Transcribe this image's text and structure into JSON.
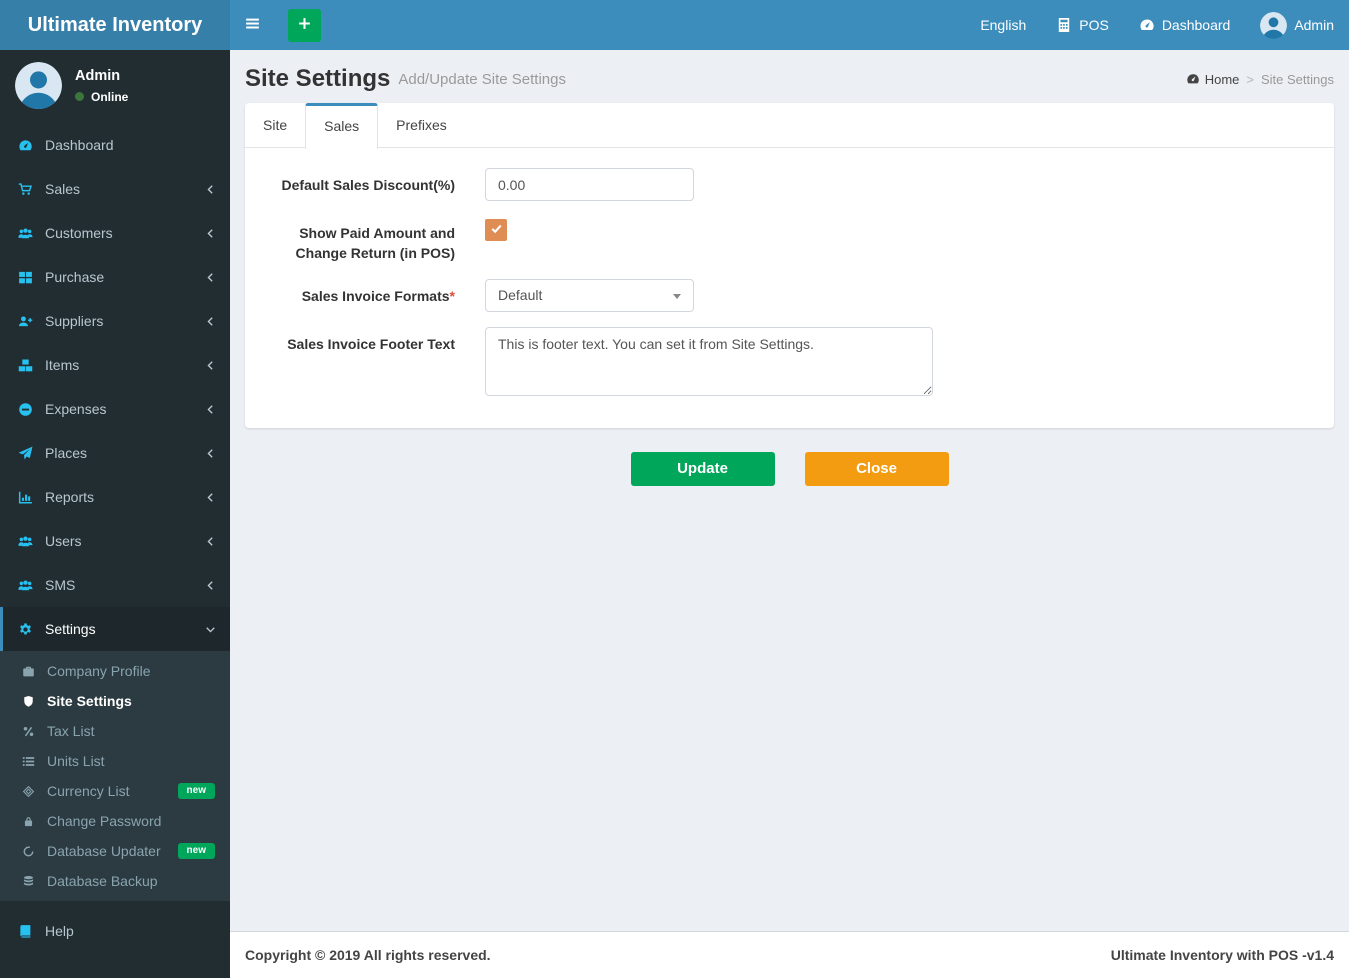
{
  "brand": {
    "title": "Ultimate Inventory"
  },
  "navbar": {
    "language": "English",
    "pos": {
      "label": "POS",
      "icon": "calculator"
    },
    "dashboard": {
      "label": "Dashboard",
      "icon": "gauge"
    },
    "user": {
      "label": "Admin",
      "icon": "person-avatar"
    }
  },
  "user_panel": {
    "name": "Admin",
    "status": "Online"
  },
  "sidebar": {
    "items": [
      {
        "label": "Dashboard",
        "icon": "gauge"
      },
      {
        "label": "Sales",
        "icon": "cart"
      },
      {
        "label": "Customers",
        "icon": "users"
      },
      {
        "label": "Purchase",
        "icon": "grid"
      },
      {
        "label": "Suppliers",
        "icon": "user-plus"
      },
      {
        "label": "Items",
        "icon": "cubes"
      },
      {
        "label": "Expenses",
        "icon": "minus-circle"
      },
      {
        "label": "Places",
        "icon": "paper-plane"
      },
      {
        "label": "Reports",
        "icon": "bar-chart"
      },
      {
        "label": "Users",
        "icon": "users"
      },
      {
        "label": "SMS",
        "icon": "users"
      },
      {
        "label": "Settings",
        "icon": "gears"
      }
    ],
    "settings_submenu": [
      {
        "label": "Company Profile",
        "icon": "briefcase"
      },
      {
        "label": "Site Settings",
        "icon": "shield"
      },
      {
        "label": "Tax List",
        "icon": "percent"
      },
      {
        "label": "Units List",
        "icon": "list"
      },
      {
        "label": "Currency List",
        "icon": "diamond",
        "badge": "new"
      },
      {
        "label": "Change Password",
        "icon": "lock"
      },
      {
        "label": "Database Updater",
        "icon": "circle-open",
        "badge": "new"
      },
      {
        "label": "Database Backup",
        "icon": "database"
      }
    ],
    "help_item": {
      "label": "Help",
      "icon": "book"
    }
  },
  "page": {
    "title": "Site Settings",
    "subtitle": "Add/Update Site Settings",
    "breadcrumb": {
      "home": "Home",
      "current": "Site Settings"
    }
  },
  "tabs": [
    {
      "label": "Site"
    },
    {
      "label": "Sales"
    },
    {
      "label": "Prefixes"
    }
  ],
  "form": {
    "discount": {
      "label": "Default Sales Discount(%)",
      "value": "0.00"
    },
    "paid_amount": {
      "label": "Show Paid Amount and Change Return (in POS)",
      "checked": true
    },
    "invoice_format": {
      "label": "Sales Invoice Formats",
      "required_mark": "*",
      "value": "Default"
    },
    "footer_text": {
      "label": "Sales Invoice Footer Text",
      "value": "This is footer text. You can set it from Site Settings."
    }
  },
  "actions": {
    "update": "Update",
    "close": "Close"
  },
  "footer": {
    "copyright": "Copyright © 2019 All rights reserved.",
    "version": "Ultimate Inventory with POS -v1.4"
  },
  "colors": {
    "navbar": "#3c8dbc",
    "brand": "#367fa9",
    "sidebar": "#222d32",
    "submenu": "#2c3b41",
    "sidebar_active": "#1e282c",
    "icon_accent": "#27c1f0",
    "success": "#00a65a",
    "warning": "#f39c12",
    "checkbox": "#df8c55",
    "content_bg": "#ecf0f5"
  }
}
